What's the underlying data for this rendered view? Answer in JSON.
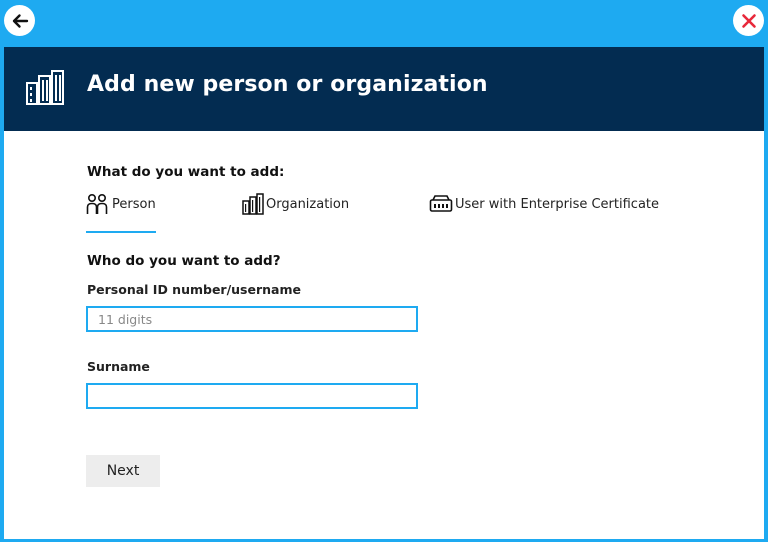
{
  "window": {
    "back_icon": "arrow-left-icon",
    "close_icon": "close-x-icon",
    "accent_color": "#1eaaf1",
    "header_color": "#032c51",
    "close_color": "#e8283a"
  },
  "header": {
    "icon": "building-icon",
    "title": "Add new person or organization"
  },
  "form": {
    "what_label": "What do you want to add:",
    "types": [
      {
        "label": "Person",
        "icon": "person-icon",
        "selected": true
      },
      {
        "label": "Organization",
        "icon": "building-icon",
        "selected": false
      },
      {
        "label": "User with Enterprise Certificate",
        "icon": "certificate-device-icon",
        "selected": false
      }
    ],
    "who_label": "Who do you want to add?",
    "id_field": {
      "label": "Personal ID number/username",
      "placeholder": "11 digits",
      "value": ""
    },
    "surname_field": {
      "label": "Surname",
      "placeholder": "",
      "value": ""
    },
    "next_label": "Next"
  }
}
